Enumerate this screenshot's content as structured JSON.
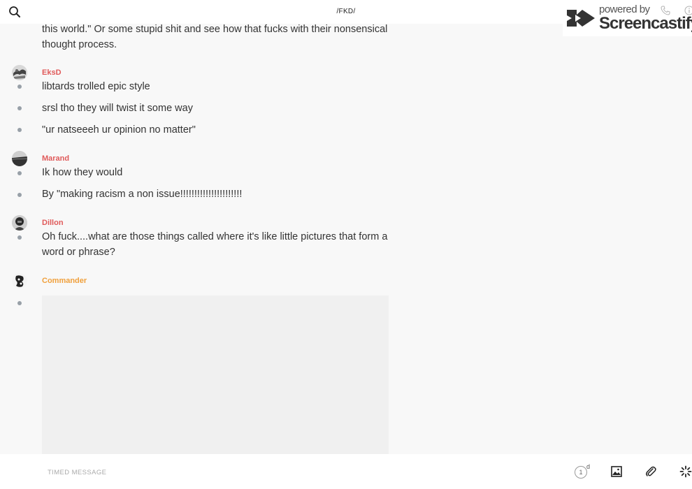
{
  "header": {
    "room_title": "/FKD/"
  },
  "watermark": {
    "powered_by": "powered by",
    "brand": "Screencastify"
  },
  "messages": {
    "partial_text": "this world.\" Or some stupid shit and see how that fucks with their nonsensical thought process.",
    "groups": [
      {
        "author": "EksD",
        "author_color": "#e05a5a",
        "lines": [
          "libtards trolled epic style",
          "srsl tho they will twist it some way",
          "\"ur natseeeh ur opinion no matter\""
        ]
      },
      {
        "author": "Marand",
        "author_color": "#e05a5a",
        "lines": [
          "Ik how they would",
          "By \"making racism a non issue!!!!!!!!!!!!!!!!!!!!!!"
        ]
      },
      {
        "author": "Dillon",
        "author_color": "#e05a5a",
        "lines": [
          "Oh fuck....what are those things called where it's like little pictures that form a word or phrase?"
        ]
      },
      {
        "author": "Commander",
        "author_color": "#f0a03c",
        "lines": []
      }
    ]
  },
  "composer": {
    "placeholder": "TIMED MESSAGE",
    "timer_value": "1",
    "timer_unit": "d"
  },
  "icons": {
    "search": "search-icon",
    "phone": "phone-icon",
    "info": "info-icon",
    "image": "image-icon",
    "attach": "paperclip-icon",
    "loading": "spinner-icon"
  }
}
